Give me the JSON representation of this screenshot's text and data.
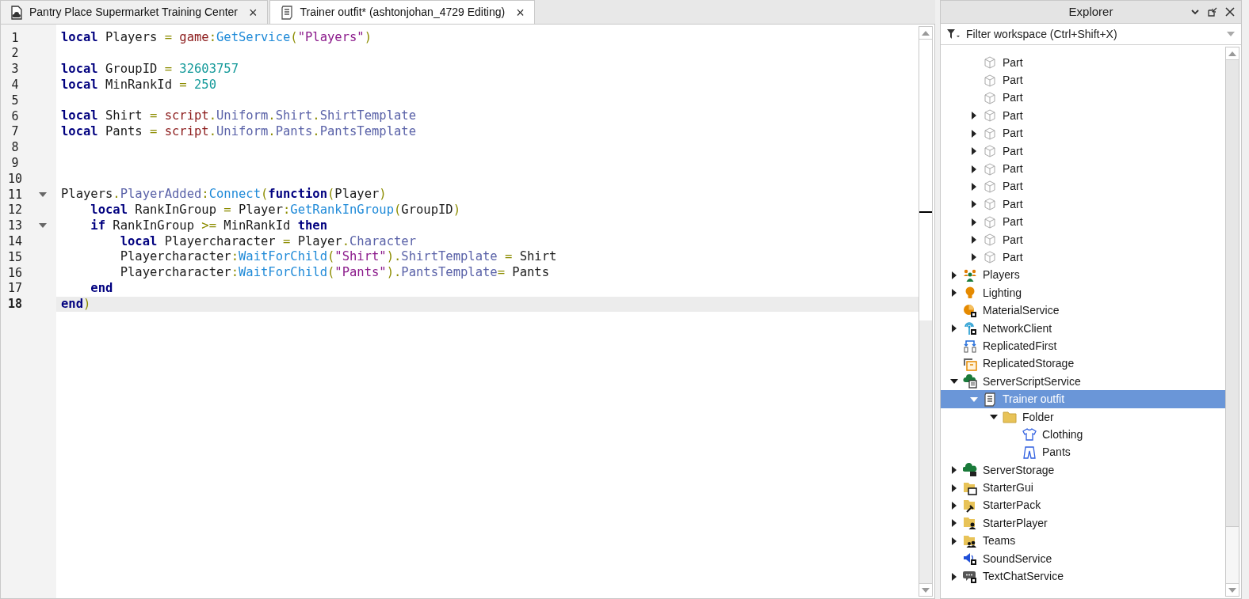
{
  "tabs": [
    {
      "label": "Pantry Place Supermarket Training Center",
      "kind": "place",
      "selected": false,
      "close": "×"
    },
    {
      "label": "Trainer outfit* (ashtonjohan_4729 Editing)",
      "kind": "script",
      "selected": true,
      "close": "×"
    }
  ],
  "editor": {
    "lines": [
      {
        "number": "1",
        "tokens": [
          {
            "text": "local",
            "kind": "kw"
          },
          {
            "text": " Players ",
            "kind": "id"
          },
          {
            "text": "=",
            "kind": "op"
          },
          {
            "text": " game",
            "kind": "global"
          },
          {
            "text": ":",
            "kind": "op"
          },
          {
            "text": "GetService",
            "kind": "method"
          },
          {
            "text": "(",
            "kind": "op"
          },
          {
            "text": "\"Players\"",
            "kind": "str"
          },
          {
            "text": ")",
            "kind": "op"
          }
        ]
      },
      {
        "number": "2"
      },
      {
        "number": "3",
        "tokens": [
          {
            "text": "local",
            "kind": "kw"
          },
          {
            "text": " GroupID ",
            "kind": "id"
          },
          {
            "text": "=",
            "kind": "op"
          },
          {
            "text": " 32603757",
            "kind": "num"
          }
        ]
      },
      {
        "number": "4",
        "tokens": [
          {
            "text": "local",
            "kind": "kw"
          },
          {
            "text": " MinRankId ",
            "kind": "id"
          },
          {
            "text": "=",
            "kind": "op"
          },
          {
            "text": " 250",
            "kind": "num"
          }
        ]
      },
      {
        "number": "5"
      },
      {
        "number": "6",
        "tokens": [
          {
            "text": "local",
            "kind": "kw"
          },
          {
            "text": " Shirt ",
            "kind": "id"
          },
          {
            "text": "=",
            "kind": "op"
          },
          {
            "text": " script",
            "kind": "global"
          },
          {
            "text": ".",
            "kind": "op"
          },
          {
            "text": "Uniform",
            "kind": "member"
          },
          {
            "text": ".",
            "kind": "op"
          },
          {
            "text": "Shirt",
            "kind": "member"
          },
          {
            "text": ".",
            "kind": "op"
          },
          {
            "text": "ShirtTemplate",
            "kind": "member"
          }
        ]
      },
      {
        "number": "7",
        "tokens": [
          {
            "text": "local",
            "kind": "kw"
          },
          {
            "text": " Pants ",
            "kind": "id"
          },
          {
            "text": "=",
            "kind": "op"
          },
          {
            "text": " script",
            "kind": "global"
          },
          {
            "text": ".",
            "kind": "op"
          },
          {
            "text": "Uniform",
            "kind": "member"
          },
          {
            "text": ".",
            "kind": "op"
          },
          {
            "text": "Pants",
            "kind": "member"
          },
          {
            "text": ".",
            "kind": "op"
          },
          {
            "text": "PantsTemplate",
            "kind": "member"
          }
        ]
      },
      {
        "number": "8"
      },
      {
        "number": "9"
      },
      {
        "number": "10"
      },
      {
        "number": "11",
        "fold": true,
        "tokens": [
          {
            "text": "Players",
            "kind": "id"
          },
          {
            "text": ".",
            "kind": "op"
          },
          {
            "text": "PlayerAdded",
            "kind": "member"
          },
          {
            "text": ":",
            "kind": "op"
          },
          {
            "text": "Connect",
            "kind": "method"
          },
          {
            "text": "(",
            "kind": "op"
          },
          {
            "text": "function",
            "kind": "kw"
          },
          {
            "text": "(",
            "kind": "op"
          },
          {
            "text": "Player",
            "kind": "id"
          },
          {
            "text": ")",
            "kind": "op"
          }
        ]
      },
      {
        "number": "12",
        "tokens": [
          {
            "text": "    local",
            "kind": "kw"
          },
          {
            "text": " RankInGroup ",
            "kind": "id"
          },
          {
            "text": "=",
            "kind": "op"
          },
          {
            "text": " Player",
            "kind": "id"
          },
          {
            "text": ":",
            "kind": "op"
          },
          {
            "text": "GetRankInGroup",
            "kind": "method"
          },
          {
            "text": "(",
            "kind": "op"
          },
          {
            "text": "GroupID",
            "kind": "id"
          },
          {
            "text": ")",
            "kind": "op"
          }
        ]
      },
      {
        "number": "13",
        "fold": true,
        "tokens": [
          {
            "text": "    if",
            "kind": "kw"
          },
          {
            "text": " RankInGroup ",
            "kind": "id"
          },
          {
            "text": ">=",
            "kind": "op"
          },
          {
            "text": " MinRankId ",
            "kind": "id"
          },
          {
            "text": "then",
            "kind": "kw"
          }
        ]
      },
      {
        "number": "14",
        "tokens": [
          {
            "text": "        local",
            "kind": "kw"
          },
          {
            "text": " Playercharacter ",
            "kind": "id"
          },
          {
            "text": "=",
            "kind": "op"
          },
          {
            "text": " Player",
            "kind": "id"
          },
          {
            "text": ".",
            "kind": "op"
          },
          {
            "text": "Character",
            "kind": "member"
          }
        ]
      },
      {
        "number": "15",
        "tokens": [
          {
            "text": "        Playercharacter",
            "kind": "id"
          },
          {
            "text": ":",
            "kind": "op"
          },
          {
            "text": "WaitForChild",
            "kind": "method"
          },
          {
            "text": "(",
            "kind": "op"
          },
          {
            "text": "\"Shirt\"",
            "kind": "str"
          },
          {
            "text": ")",
            "kind": "op"
          },
          {
            "text": ".",
            "kind": "op"
          },
          {
            "text": "ShirtTemplate",
            "kind": "member"
          },
          {
            "text": " =",
            "kind": "op"
          },
          {
            "text": " Shirt",
            "kind": "id"
          }
        ]
      },
      {
        "number": "16",
        "tokens": [
          {
            "text": "        Playercharacter",
            "kind": "id"
          },
          {
            "text": ":",
            "kind": "op"
          },
          {
            "text": "WaitForChild",
            "kind": "method"
          },
          {
            "text": "(",
            "kind": "op"
          },
          {
            "text": "\"Pants\"",
            "kind": "str"
          },
          {
            "text": ")",
            "kind": "op"
          },
          {
            "text": ".",
            "kind": "op"
          },
          {
            "text": "PantsTemplate",
            "kind": "member"
          },
          {
            "text": "=",
            "kind": "op"
          },
          {
            "text": " Pants",
            "kind": "id"
          }
        ]
      },
      {
        "number": "17",
        "tokens": [
          {
            "text": "    end",
            "kind": "kw"
          }
        ]
      },
      {
        "number": "18",
        "current": true,
        "tokens": [
          {
            "text": "end",
            "kind": "kw"
          },
          {
            "text": ")",
            "kind": "op"
          }
        ]
      }
    ]
  },
  "explorer": {
    "title": "Explorer",
    "filter_placeholder": "Filter workspace (Ctrl+Shift+X)",
    "partial_branch": [
      {
        "label": "Part",
        "kind": "part",
        "expandable": false,
        "selected": false
      },
      {
        "label": "Part",
        "kind": "part",
        "expandable": false,
        "selected": false
      },
      {
        "label": "Part",
        "kind": "part",
        "expandable": false,
        "selected": false
      },
      {
        "label": "Part",
        "kind": "part",
        "expandable": true,
        "expanded": false,
        "selected": false
      },
      {
        "label": "Part",
        "kind": "part",
        "expandable": true,
        "expanded": false,
        "selected": false
      },
      {
        "label": "Part",
        "kind": "part",
        "expandable": true,
        "expanded": false,
        "selected": false
      },
      {
        "label": "Part",
        "kind": "part",
        "expandable": true,
        "expanded": false,
        "selected": false
      },
      {
        "label": "Part",
        "kind": "part",
        "expandable": true,
        "expanded": false,
        "selected": false
      },
      {
        "label": "Part",
        "kind": "part",
        "expandable": true,
        "expanded": false,
        "selected": false
      },
      {
        "label": "Part",
        "kind": "part",
        "expandable": true,
        "expanded": false,
        "selected": false
      },
      {
        "label": "Part",
        "kind": "part",
        "expandable": true,
        "expanded": false,
        "selected": false
      },
      {
        "label": "Part",
        "kind": "part",
        "expandable": true,
        "expanded": false,
        "selected": false
      }
    ],
    "items": [
      {
        "label": "Players",
        "kind": "players",
        "expandable": true,
        "expanded": false,
        "selected": false
      },
      {
        "label": "Lighting",
        "kind": "lighting",
        "expandable": true,
        "expanded": false,
        "selected": false
      },
      {
        "label": "MaterialService",
        "kind": "material",
        "expandable": false,
        "selected": false
      },
      {
        "label": "NetworkClient",
        "kind": "network",
        "expandable": true,
        "expanded": false,
        "selected": false
      },
      {
        "label": "ReplicatedFirst",
        "kind": "replicated-first",
        "expandable": false,
        "selected": false
      },
      {
        "label": "ReplicatedStorage",
        "kind": "replicated-storage",
        "expandable": false,
        "selected": false
      },
      {
        "label": "ServerScriptService",
        "kind": "cloud-script",
        "expandable": true,
        "expanded": true,
        "selected": false,
        "children": [
          {
            "label": "Trainer outfit",
            "kind": "script",
            "expandable": true,
            "expanded": true,
            "selected": true,
            "children": [
              {
                "label": "Folder",
                "kind": "folder",
                "expandable": true,
                "expanded": true,
                "selected": false,
                "children": [
                  {
                    "label": "Clothing",
                    "kind": "shirt",
                    "expandable": false,
                    "selected": false
                  },
                  {
                    "label": "Pants",
                    "kind": "pants",
                    "expandable": false,
                    "selected": false
                  }
                ]
              }
            ]
          }
        ]
      },
      {
        "label": "ServerStorage",
        "kind": "cloud-storage",
        "expandable": true,
        "expanded": false,
        "selected": false
      },
      {
        "label": "StarterGui",
        "kind": "folder-window",
        "expandable": true,
        "expanded": false,
        "selected": false
      },
      {
        "label": "StarterPack",
        "kind": "folder-hammer",
        "expandable": true,
        "expanded": false,
        "selected": false
      },
      {
        "label": "StarterPlayer",
        "kind": "folder-person",
        "expandable": true,
        "expanded": false,
        "selected": false
      },
      {
        "label": "Teams",
        "kind": "folder-people",
        "expandable": true,
        "expanded": false,
        "selected": false
      },
      {
        "label": "SoundService",
        "kind": "speaker",
        "expandable": false,
        "selected": false
      },
      {
        "label": "TextChatService",
        "kind": "chat",
        "expandable": true,
        "expanded": false,
        "selected": false
      }
    ]
  }
}
